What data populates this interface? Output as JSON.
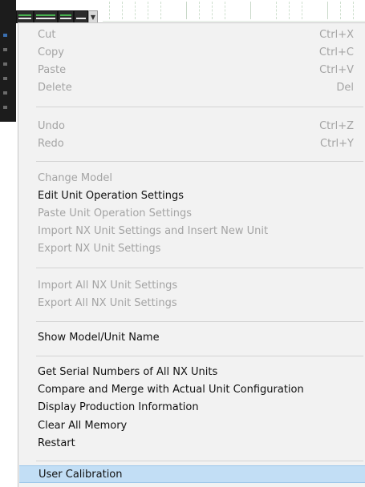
{
  "menu": {
    "clipboard": [
      {
        "label": "Cut",
        "shortcut": "Ctrl+X",
        "enabled": false
      },
      {
        "label": "Copy",
        "shortcut": "Ctrl+C",
        "enabled": false
      },
      {
        "label": "Paste",
        "shortcut": "Ctrl+V",
        "enabled": false
      },
      {
        "label": "Delete",
        "shortcut": "Del",
        "enabled": false
      }
    ],
    "history": [
      {
        "label": "Undo",
        "shortcut": "Ctrl+Z",
        "enabled": false
      },
      {
        "label": "Redo",
        "shortcut": "Ctrl+Y",
        "enabled": false
      }
    ],
    "unit_settings": [
      {
        "label": "Change Model",
        "enabled": false
      },
      {
        "label": "Edit Unit Operation Settings",
        "enabled": true
      },
      {
        "label": "Paste Unit Operation Settings",
        "enabled": false
      },
      {
        "label": "Import NX Unit Settings and Insert New Unit",
        "enabled": false
      },
      {
        "label": "Export NX Unit Settings",
        "enabled": false
      }
    ],
    "all_units": [
      {
        "label": "Import All NX Unit Settings",
        "enabled": false
      },
      {
        "label": "Export All NX Unit Settings",
        "enabled": false
      }
    ],
    "view": [
      {
        "label": "Show Model/Unit Name",
        "enabled": true
      }
    ],
    "tools": [
      {
        "label": "Get Serial Numbers of All NX Units",
        "enabled": true
      },
      {
        "label": "Compare and Merge with Actual Unit Configuration",
        "enabled": true
      },
      {
        "label": "Display Production Information",
        "enabled": true
      },
      {
        "label": "Clear All Memory",
        "enabled": true
      },
      {
        "label": "Restart",
        "enabled": true
      }
    ],
    "calibration": [
      {
        "label": "User Calibration",
        "enabled": true,
        "highlighted": true
      }
    ]
  },
  "colors": {
    "menu_background": "#f2f2f2",
    "disabled_text": "#a4a4a4",
    "enabled_text": "#111111",
    "highlight": "#c2def5",
    "unit_led_green": "#47b24f"
  }
}
